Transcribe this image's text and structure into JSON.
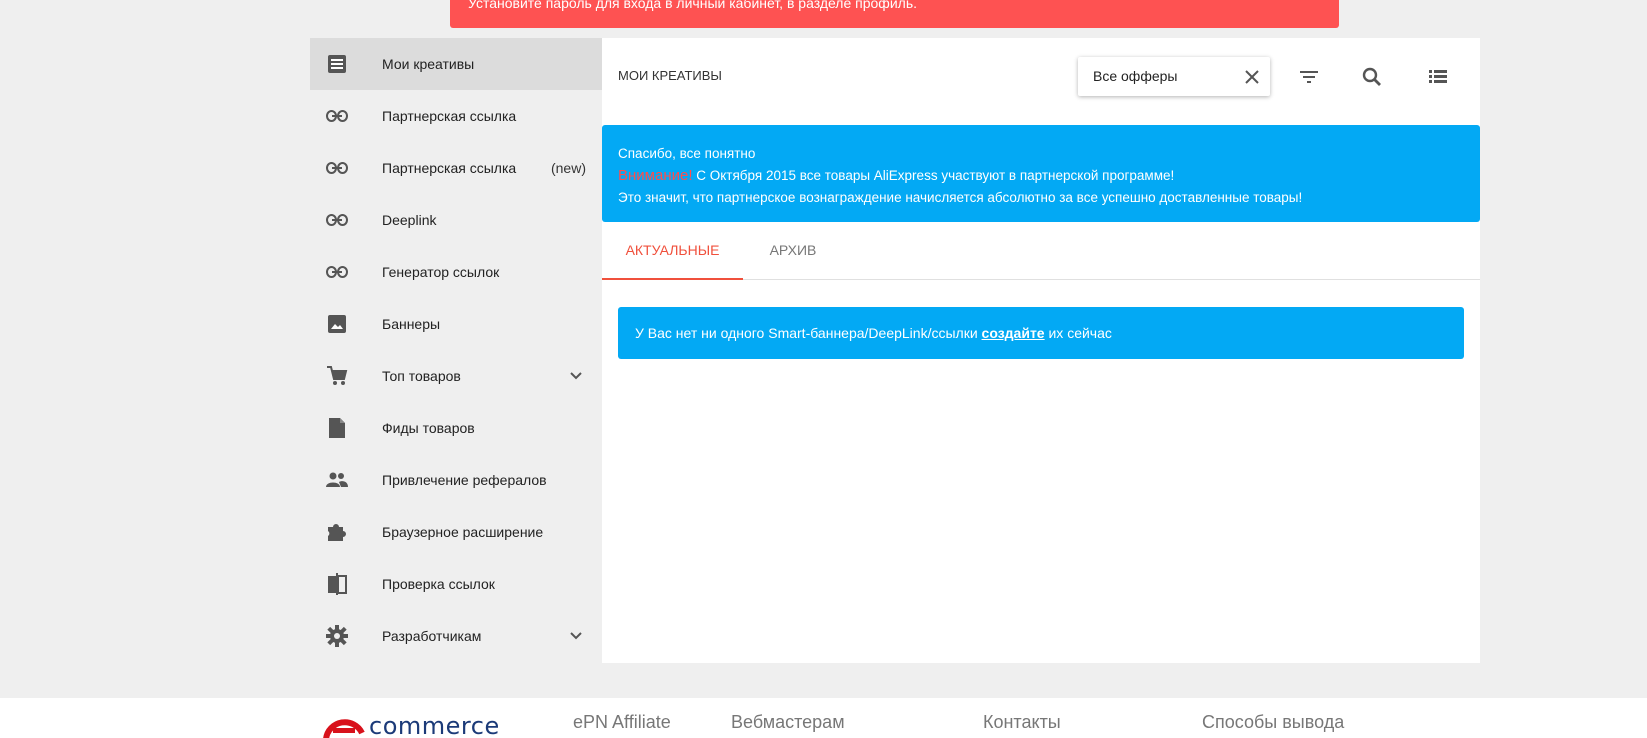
{
  "top_alert": {
    "text": "Установите пароль для входа в личный кабинет, в разделе профиль."
  },
  "sidebar": {
    "items": [
      {
        "label": "Мои креативы",
        "icon": "list-doc-icon",
        "active": true
      },
      {
        "label": "Партнерская ссылка",
        "icon": "link-icon"
      },
      {
        "label": "Партнерская ссылка",
        "icon": "link-icon",
        "extra": "(new)"
      },
      {
        "label": "Deeplink",
        "icon": "link-icon"
      },
      {
        "label": "Генератор ссылок",
        "icon": "link-icon"
      },
      {
        "label": "Баннеры",
        "icon": "image-icon"
      },
      {
        "label": "Топ товаров",
        "icon": "cart-icon",
        "expandable": true
      },
      {
        "label": "Фиды товаров",
        "icon": "file-icon"
      },
      {
        "label": "Привлечение рефералов",
        "icon": "people-icon"
      },
      {
        "label": "Браузерное расширение",
        "icon": "puzzle-icon"
      },
      {
        "label": "Проверка ссылок",
        "icon": "compare-icon"
      },
      {
        "label": "Разработчикам",
        "icon": "gear-icon",
        "expandable": true
      }
    ]
  },
  "header": {
    "title": "МОИ КРЕАТИВЫ",
    "offer_select": {
      "value": "Все офферы"
    }
  },
  "notice": {
    "dismiss": "Спасибо, все понятно",
    "warning": "Внимание!",
    "line1": " С Октября 2015 все товары AliExpress участвуют в партнерской программе!",
    "line2": "Это значит, что партнерское вознаграждение начисляется абсолютно за все успешно доставленные товары!"
  },
  "tabs": [
    {
      "label": "Актуальные",
      "active": true
    },
    {
      "label": "Архив",
      "active": false
    }
  ],
  "empty": {
    "before": "У Вас нет ни одного Smart-баннера/DeepLink/ссылки ",
    "link": "создайте",
    "after": " их сейчас"
  },
  "footer": {
    "logo_text": "commerce",
    "links": [
      "ePN Affiliate",
      "Вебмастерам",
      "Контакты",
      "Способы вывода"
    ]
  },
  "colors": {
    "accent": "#fe5252",
    "info": "#03a9f4",
    "tab_active": "#f0503c",
    "logo": "#1b3a78"
  }
}
